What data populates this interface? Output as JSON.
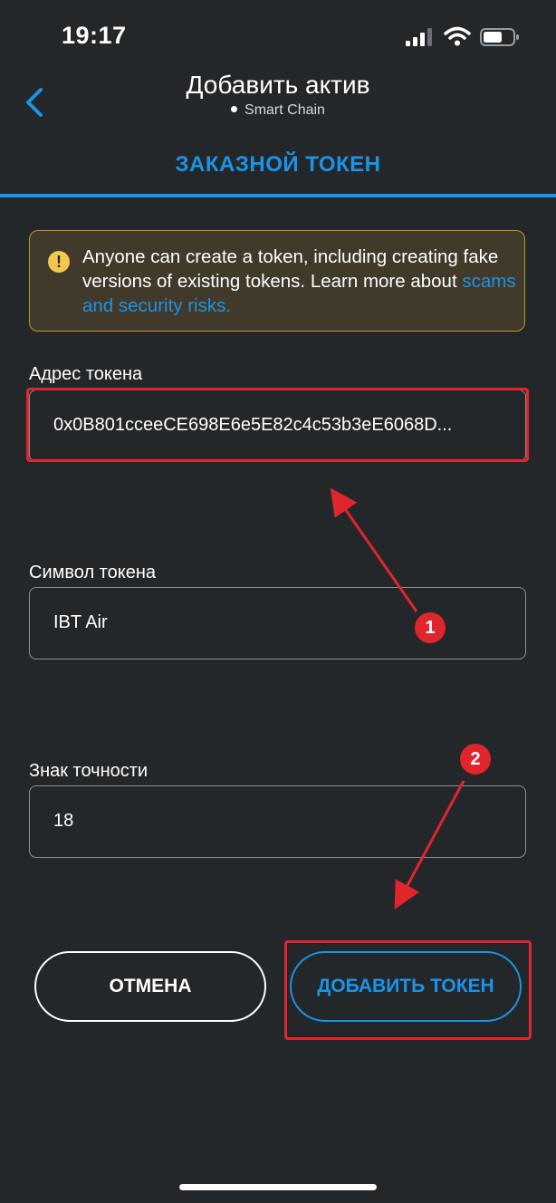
{
  "status_bar": {
    "time": "19:17"
  },
  "header": {
    "title": "Добавить актив",
    "network": "Smart Chain",
    "tab": "ЗАКАЗНОЙ ТОКЕН"
  },
  "warning": {
    "text": "Anyone can create a token, including creating fake versions of existing tokens. Learn more about ",
    "link": "scams and security risks."
  },
  "form": {
    "address_label": "Адрес токена",
    "address_value": "0x0B801cceeCE698E6e5E82c4c53b3eE6068D...",
    "symbol_label": "Символ токена",
    "symbol_value": "IBT Air",
    "decimals_label": "Знак точности",
    "decimals_value": "18"
  },
  "buttons": {
    "cancel": "ОТМЕНА",
    "add": "ДОБАВИТЬ ТОКЕН"
  },
  "annotations": {
    "badge_1": "1",
    "badge_2": "2",
    "color": "#e0262c"
  },
  "colors": {
    "accent": "#1a94e8",
    "background": "#24272a",
    "warning_bg": "#41392a",
    "warning_border": "#b99a2e"
  },
  "icons": [
    "back-chevron-icon",
    "signal-icon",
    "wifi-icon",
    "battery-icon",
    "warning-icon"
  ]
}
